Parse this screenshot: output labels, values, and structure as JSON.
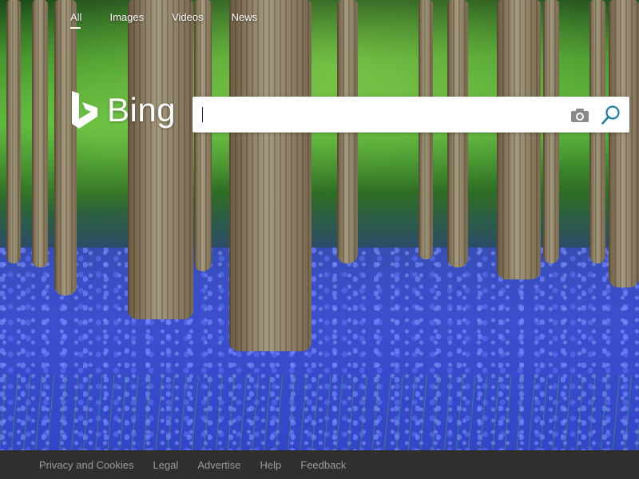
{
  "nav": {
    "items": [
      {
        "label": "All",
        "active": true
      },
      {
        "label": "Images",
        "active": false
      },
      {
        "label": "Videos",
        "active": false
      },
      {
        "label": "News",
        "active": false
      }
    ]
  },
  "logo": {
    "text": "Bing"
  },
  "search": {
    "value": "",
    "placeholder": "",
    "camera_icon": "camera-icon",
    "search_icon": "search-icon"
  },
  "footer": {
    "links": [
      "Privacy and Cookies",
      "Legal",
      "Advertise",
      "Help",
      "Feedback"
    ]
  },
  "colors": {
    "footer_bg": "#2f2f2f",
    "footer_text": "#9a9a9a",
    "search_icon": "#1f7ea8",
    "camera_icon": "#8a8a8a"
  }
}
